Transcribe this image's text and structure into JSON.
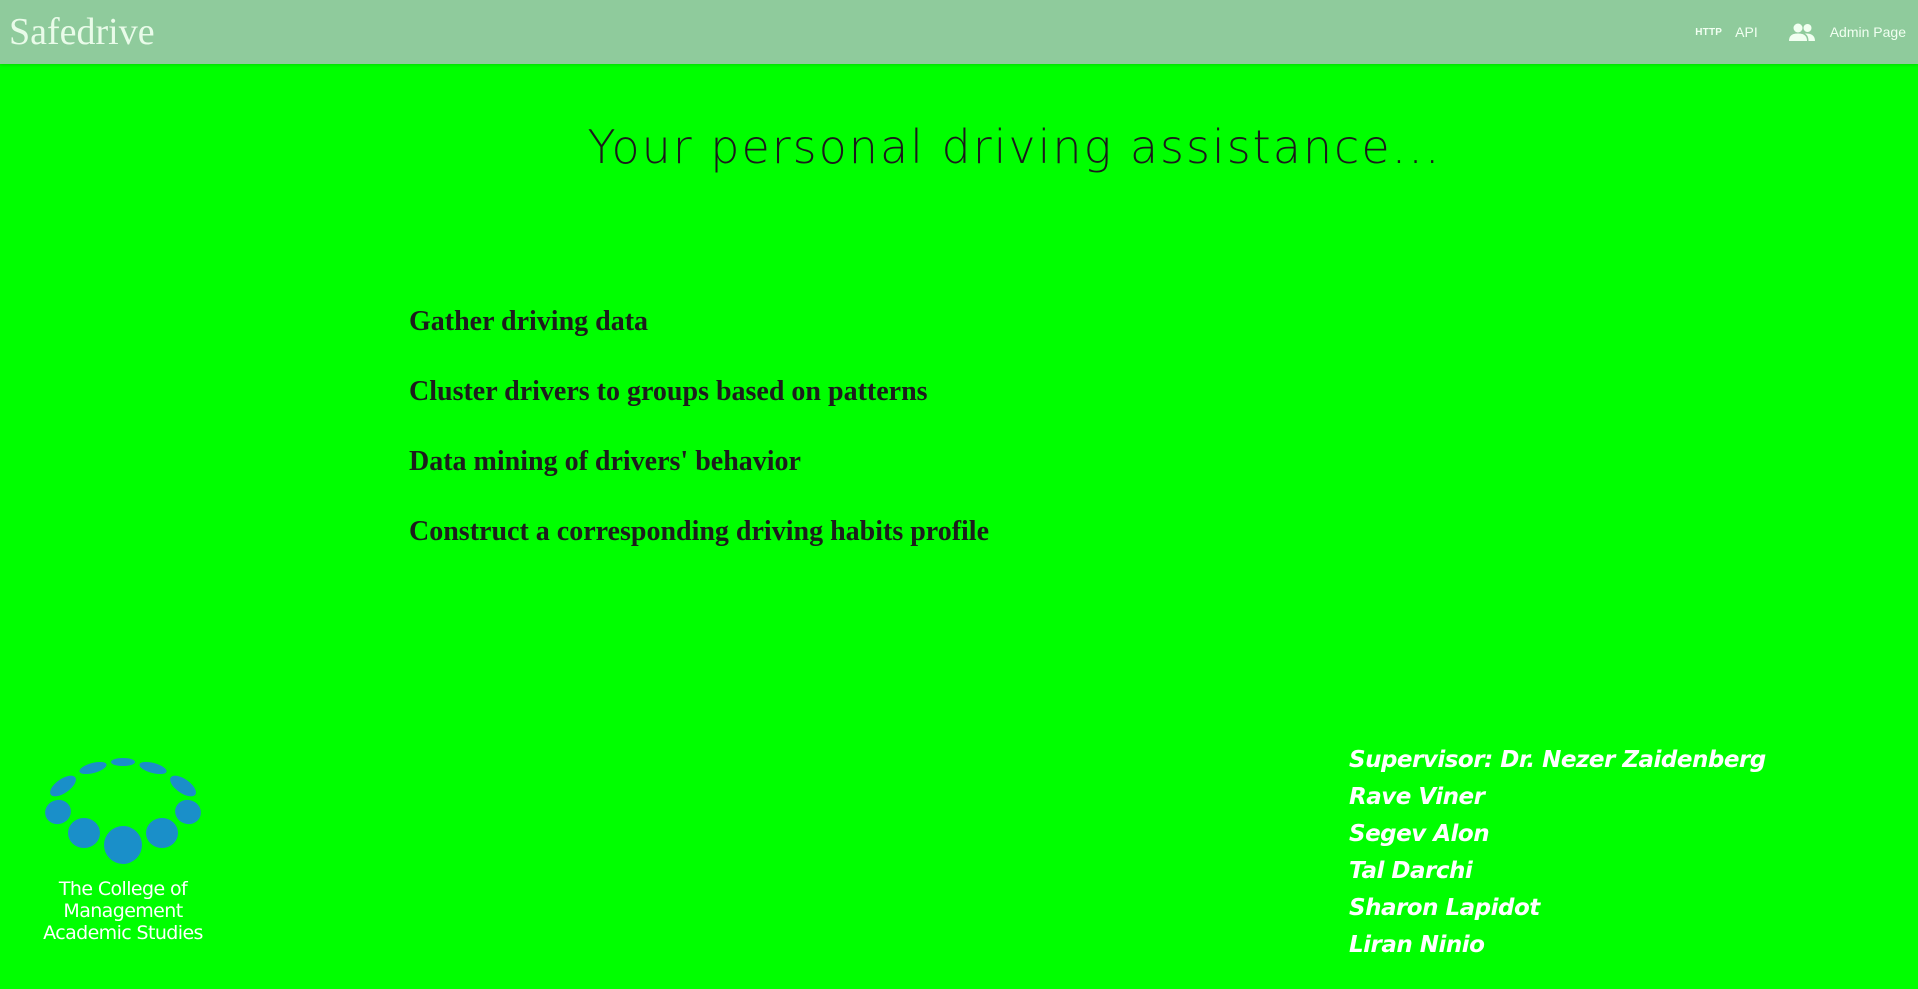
{
  "navbar": {
    "brand": "Safedrive",
    "http_icon_text": "HTTP",
    "api_label": "API",
    "admin_label": "Admin Page",
    "icons": [
      "http-icon",
      "people-icon"
    ]
  },
  "hero": {
    "title": "Your personal driving assistance..."
  },
  "features": [
    "Gather driving data",
    "Cluster drivers to groups based on patterns",
    "Data mining of drivers' behavior",
    "Construct a corresponding driving habits profile"
  ],
  "logo": {
    "line1": "The College of Management",
    "line2": "Academic Studies",
    "color": "#1a8fc9"
  },
  "credits": [
    "Supervisor: Dr. Nezer Zaidenberg",
    "Rave Viner",
    "Segev Alon",
    "Tal Darchi",
    "Sharon Lapidot",
    "Liran Ninio"
  ],
  "colors": {
    "background": "#00ff00",
    "navbar": "#8fcb9c"
  }
}
